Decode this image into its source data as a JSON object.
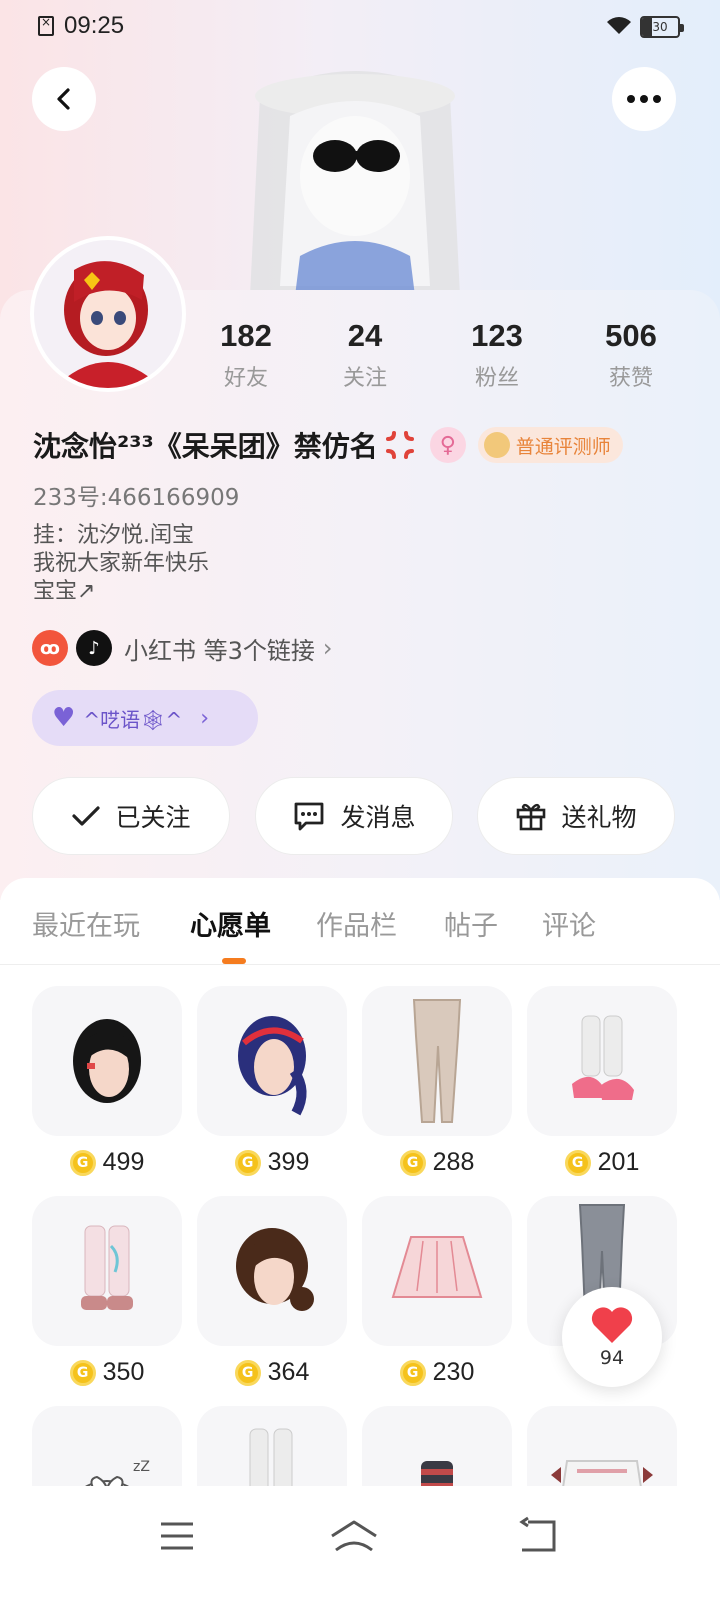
{
  "status_bar": {
    "time": "09:25",
    "battery": "30"
  },
  "profile": {
    "stats": [
      {
        "num": "182",
        "label": "好友"
      },
      {
        "num": "24",
        "label": "关注"
      },
      {
        "num": "123",
        "label": "粉丝"
      },
      {
        "num": "506",
        "label": "获赞"
      }
    ],
    "name": "沈念怡²³³《呆呆团》禁仿名",
    "gender_symbol": "♀",
    "role_badge": "普通评测师",
    "uid": "233号:466166909",
    "bio": [
      "挂：沈汐悦.闰宝",
      "我祝大家新年快乐",
      "宝宝↗"
    ],
    "links_text": "小红书 等3个链接",
    "tag_text": "^呓语🕸^"
  },
  "actions": {
    "follow": "已关注",
    "message": "发消息",
    "gift": "送礼物"
  },
  "tabs": [
    "最近在玩",
    "心愿单",
    "作品栏",
    "帖子",
    "评论"
  ],
  "active_tab": "心愿单",
  "wishlist": [
    {
      "name": "black-short-hair",
      "price": "499"
    },
    {
      "name": "navy-ponytail-hair",
      "price": "399"
    },
    {
      "name": "beige-leggings",
      "price": "288"
    },
    {
      "name": "white-socks-pink-sandals",
      "price": "201"
    },
    {
      "name": "pink-leg-warmers",
      "price": "350"
    },
    {
      "name": "brown-bun-hair",
      "price": "364"
    },
    {
      "name": "pink-pleated-skirt",
      "price": "230"
    },
    {
      "name": "grey-pants",
      "price": ""
    }
  ],
  "like_float": {
    "count": "94"
  },
  "colors": {
    "accent": "#f57c1f",
    "coin": "#f5c21b",
    "heart": "#f0404b",
    "tag_bg": "#e5dcf7"
  }
}
